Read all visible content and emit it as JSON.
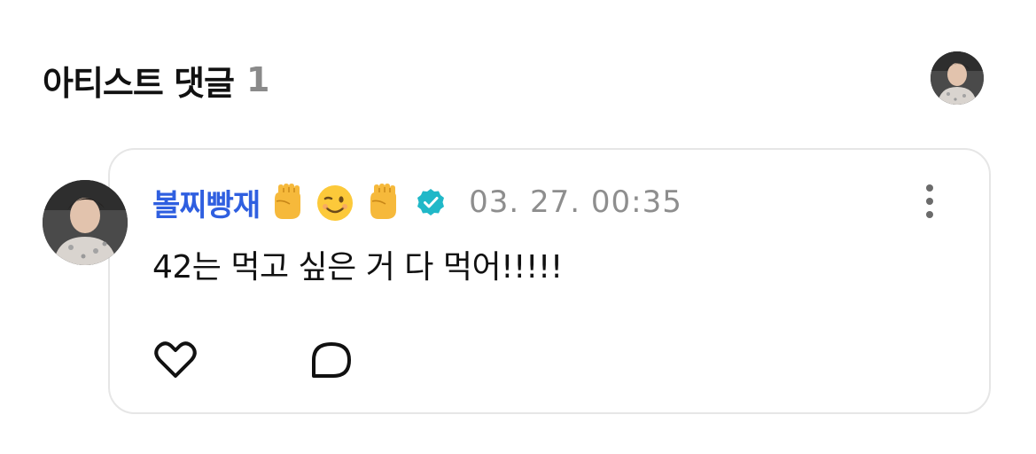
{
  "header": {
    "title": "아티스트 댓글",
    "count": "1"
  },
  "comment": {
    "username": "볼찌빵재",
    "emojis": [
      "raised-fist",
      "winking-face",
      "raised-fist"
    ],
    "verified": true,
    "timestamp": "03. 27. 00:35",
    "text": "42는 먹고 싶은 거 다 먹어!!!!!"
  },
  "colors": {
    "username": "#2f5fe0",
    "verified_badge": "#20b8c8",
    "timestamp": "#8e8e8e",
    "count": "#8a8a8a",
    "card_border": "#e6e6e6"
  },
  "icons": {
    "like": "heart-outline-icon",
    "reply": "speech-bubble-icon",
    "more": "vertical-ellipsis-icon",
    "verified": "verified-badge-icon"
  }
}
